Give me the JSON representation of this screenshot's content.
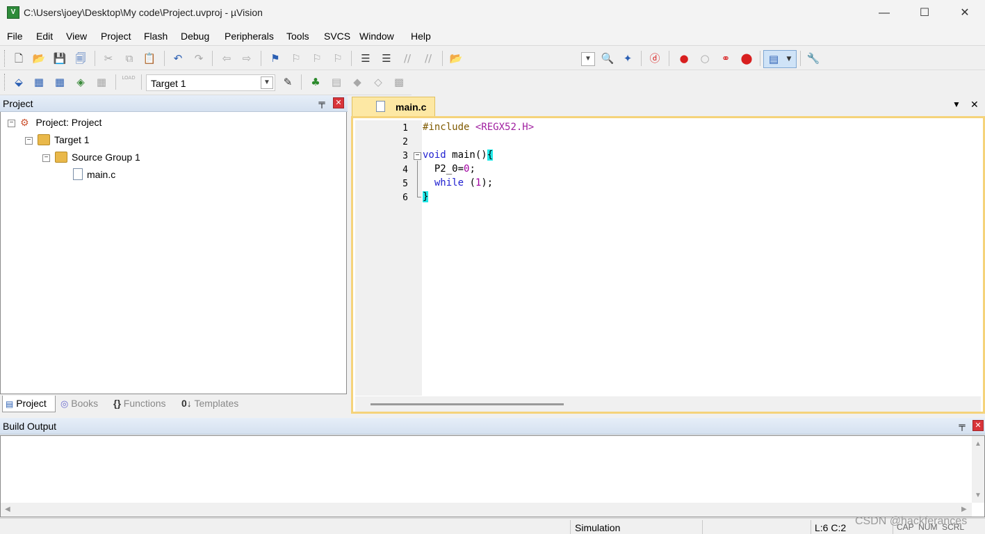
{
  "window": {
    "title": "C:\\Users\\joey\\Desktop\\My code\\Project.uvproj - µVision",
    "app_icon_text": "V",
    "minimize_glyph": "—",
    "maximize_glyph": "☐",
    "close_glyph": "✕"
  },
  "menu": [
    "File",
    "Edit",
    "View",
    "Project",
    "Flash",
    "Debug",
    "Peripherals",
    "Tools",
    "SVCS",
    "Window",
    "Help"
  ],
  "toolbar2": {
    "target_select_value": "Target 1",
    "load_label": "LOAD"
  },
  "project_panel": {
    "title": "Project",
    "pin_glyph": "📌",
    "close_glyph": "✕",
    "tree": [
      {
        "label": "Project: Project",
        "level": 0,
        "expanded": true,
        "icon": "project-icon"
      },
      {
        "label": "Target 1",
        "level": 1,
        "expanded": true,
        "icon": "target-folder-icon"
      },
      {
        "label": "Source Group 1",
        "level": 2,
        "expanded": true,
        "icon": "folder-icon"
      },
      {
        "label": "main.c",
        "level": 3,
        "icon": "c-file-icon"
      }
    ],
    "tabs": [
      {
        "label": "Project",
        "active": true,
        "icon": "project-tab-icon"
      },
      {
        "label": "Books",
        "active": false,
        "icon": "books-icon"
      },
      {
        "label": "Functions",
        "active": false,
        "icon_text": "{}"
      },
      {
        "label": "Templates",
        "active": false,
        "icon_text": "0↓"
      }
    ]
  },
  "editor": {
    "tab_label": "main.c",
    "dropdown_glyph": "▼",
    "close_glyph": "✕",
    "line_numbers": [
      "1",
      "2",
      "3",
      "4",
      "5",
      "6"
    ],
    "fold_minus": "−",
    "code": {
      "l1_pp": "#include",
      "l1_inc": "<REGX52.H>",
      "l3_kw": "void",
      "l3_rest": " main()",
      "l3_brace": "{",
      "l4_pre": "  P2_0=",
      "l4_num": "0",
      "l4_post": ";",
      "l5_kw": "while",
      "l5_mid": " (",
      "l5_num": "1",
      "l5_post": ");",
      "l6_brace": "}"
    }
  },
  "build_output": {
    "title": "Build Output",
    "pin_glyph": "📌",
    "close_glyph": "✕"
  },
  "statusbar": {
    "mode": "Simulation",
    "cursor": "L:6 C:2",
    "indicators": "CAP  NUM  SCRL"
  },
  "watermark": "CSDN @hackferances",
  "colors": {
    "editor_tab": "#fde8a4",
    "editor_border": "#f5d37a",
    "brace_highlight": "#20e8e8",
    "keyword": "#2020d0",
    "include_path": "#a020a0"
  }
}
